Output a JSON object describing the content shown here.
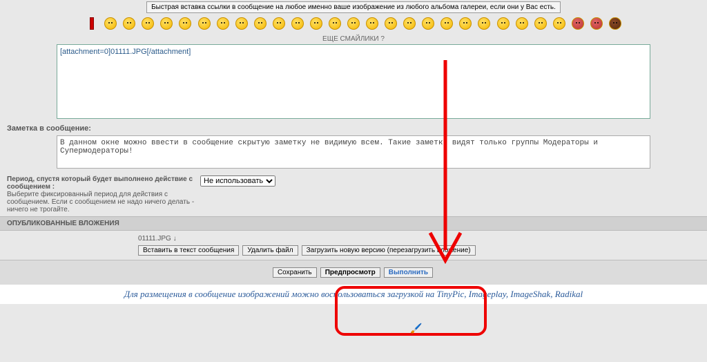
{
  "hint": "Быстрая вставка ссылки в сообщение на любое именно ваше изображение из любого альбома галереи, если они у Вас есть.",
  "smileys_more": "ЕЩЕ СМАЙЛИКИ ?",
  "message_text": "[attachment=0]01111.JPG[/attachment]",
  "note": {
    "label": "Заметка в сообщение:",
    "text": "В данном окне можно ввести в сообщение скрытую заметку не видимую всем. Такие заметки видят только группы Модераторы и Супермодераторы!"
  },
  "period": {
    "label_bold": "Период, спустя который будет выполнено действие с сообщением :",
    "label_desc": "Выберите фиксированный период для действия с сообщением. Если с сообщением не надо ничего делать - ничего не трогайте.",
    "selected": "Не использовать"
  },
  "attachments": {
    "header": "ОПУБЛИКОВАННЫЕ ВЛОЖЕНИЯ",
    "filename": "01111.JPG ↓",
    "btn_insert": "Вставить в текст сообщения",
    "btn_delete": "Удалить файл",
    "btn_reload": "Загрузить новую версию (перезагрузить вложение)"
  },
  "actions": {
    "save": "Сохранить",
    "preview": "Предпросмотр",
    "execute": "Выполнить"
  },
  "bottom": "Для размещения в сообщение изображений можно воспользоваться загрузкой на TinyPic, Imageplay, ImageShak, Radikal"
}
